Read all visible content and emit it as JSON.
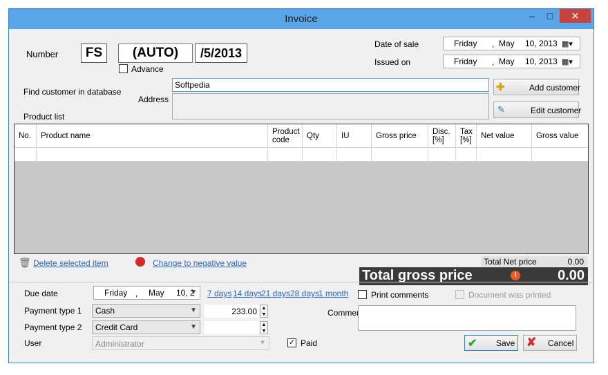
{
  "window": {
    "title": "Invoice",
    "minimize": "–",
    "maximize": "□",
    "close": "✕"
  },
  "number": {
    "label": "Number",
    "prefix": "FS",
    "auto": "(AUTO)",
    "suffix": "/5/2013",
    "advance_label": "Advance"
  },
  "dates": {
    "sale_label": "Date of sale",
    "issued_label": "Issued on",
    "sale": {
      "day": "Friday",
      "sep": ",",
      "month": "May",
      "date": "10, 2013"
    },
    "issued": {
      "day": "Friday",
      "sep": ",",
      "month": "May",
      "date": "10, 2013"
    }
  },
  "customer": {
    "find_label": "Find customer in database",
    "search_value": "Softpedia",
    "address_label": "Address",
    "add_button": "Add customer",
    "edit_button": "Edit customer",
    "product_list_label": "Product list"
  },
  "table": {
    "headers": [
      "No.",
      "Product name",
      "Product code",
      "Qty",
      "IU",
      "Gross price",
      "Disc. [%]",
      "Tax [%]",
      "Net value",
      "Gross value"
    ]
  },
  "actions": {
    "delete_selected": "Delete selected item",
    "negative_value": "Change to negative value"
  },
  "totals": {
    "net_label": "Total Net price",
    "net_value": "0.00",
    "gross_label": "Total gross price",
    "gross_value": "0.00"
  },
  "payment": {
    "due_label": "Due date",
    "due": {
      "day": "Friday",
      "sep": ",",
      "month": "May",
      "date": "10, 2"
    },
    "quick_links": [
      "7 days",
      "14 days",
      "21 days",
      "28 days",
      "1 month"
    ],
    "type1_label": "Payment type 1",
    "type1_value": "Cash",
    "type1_amount": "233.00",
    "type2_label": "Payment type 2",
    "type2_value": "Credit Card",
    "type2_amount": "",
    "user_label": "User",
    "user_value": "Administrator",
    "paid_label": "Paid",
    "print_comments_label": "Print comments",
    "printed_label": "Document was printed",
    "comment_label": "Comment"
  },
  "buttons": {
    "save": "Save",
    "cancel": "Cancel"
  },
  "colors": {
    "title_bar": "#5aa5e8",
    "close": "#c7443c",
    "link": "#2b67c9",
    "total_bar": "#3a3a3a",
    "save_icon": "#2e9e3a",
    "cancel_icon": "#d32a2a"
  }
}
